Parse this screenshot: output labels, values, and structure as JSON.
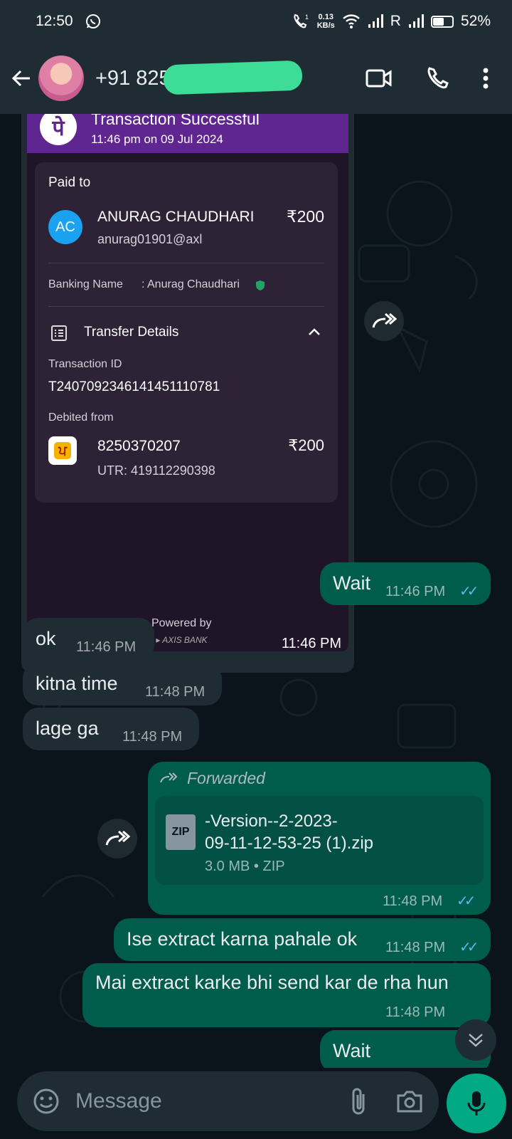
{
  "status_bar": {
    "time": "12:50",
    "net_speed_value": "0.13",
    "net_speed_unit": "KB/s",
    "roaming": "R",
    "battery": "52%",
    "battery_level": 0.52
  },
  "header": {
    "contact": "+91 825"
  },
  "transaction": {
    "title": "Transaction Successful",
    "datetime": "11:46 pm on 09 Jul 2024",
    "paid_to_label": "Paid to",
    "payee_initials": "AC",
    "payee_name": "ANURAG CHAUDHARI",
    "amount": "₹200",
    "payee_upi": "anurag01901@axl",
    "banking_name_label": "Banking Name",
    "banking_name_value": ": Anurag Chaudhari",
    "transfer_details_label": "Transfer Details",
    "transaction_id_label": "Transaction ID",
    "transaction_id": "T2407092346141451110781",
    "debited_from_label": "Debited from",
    "account": "8250370207",
    "debited_amount": "₹200",
    "utr": "UTR: 419112290398",
    "powered_by": "Powered by",
    "time": "11:46 PM"
  },
  "messages": [
    {
      "text": "Wait",
      "time": "11:46 PM"
    },
    {
      "text": "ok",
      "time": "11:46 PM"
    },
    {
      "text": "kitna time",
      "time": "11:48 PM"
    },
    {
      "text": "lage ga",
      "time": "11:48 PM"
    },
    {
      "text": "Ise extract karna pahale ok",
      "time": "11:48 PM"
    },
    {
      "text": "Mai extract karke bhi send kar de rha hun",
      "time": "11:48 PM"
    },
    {
      "text": "Wait",
      "time": ""
    }
  ],
  "file_message": {
    "forwarded_label": "Forwarded",
    "file_badge": "ZIP",
    "file_name_line1": "-Version--2-2023-",
    "file_name_line2": "09-11-12-53-25 (1).zip",
    "file_info": "3.0 MB • ZIP",
    "time": "11:48 PM"
  },
  "composer": {
    "placeholder": "Message"
  },
  "colors": {
    "chat_bg": "#0b141a",
    "incoming_bubble": "#1f2c34",
    "outgoing_bubble": "#005c4b",
    "accent": "#00a884",
    "read_ticks": "#53bdeb",
    "phonepe_purple": "#5f2590"
  },
  "icons": [
    "whatsapp-icon",
    "back-arrow-icon",
    "video-call-icon",
    "phone-icon",
    "more-vert-icon",
    "forward-icon",
    "emoji-icon",
    "attach-icon",
    "camera-icon",
    "mic-icon",
    "chevron-double-down-icon",
    "double-check-icon"
  ]
}
